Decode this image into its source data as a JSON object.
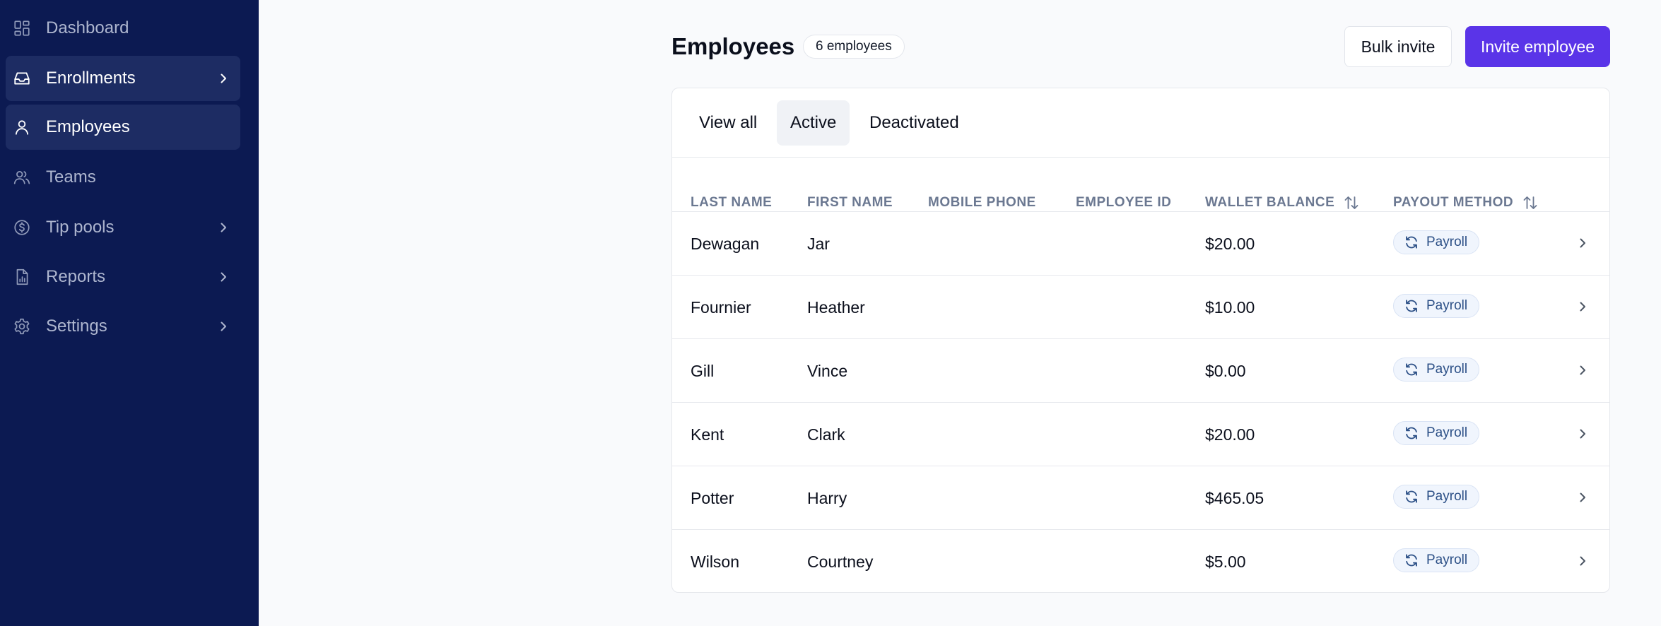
{
  "colors": {
    "sidebar_bg": "#0c1a52",
    "sidebar_active_bg": "#1d2c63",
    "accent": "#5a34e8",
    "badge_bg": "#f0f5fd",
    "badge_text": "#2b4f86"
  },
  "sidebar": {
    "items": [
      {
        "label": "Dashboard",
        "icon": "grid-icon"
      },
      {
        "label": "Enrollments",
        "icon": "inbox-icon",
        "has_chevron": true
      },
      {
        "label": "Employees",
        "icon": "user-icon",
        "selected": true
      },
      {
        "label": "Teams",
        "icon": "users-icon"
      },
      {
        "label": "Tip pools",
        "icon": "dollar-circle-icon",
        "has_chevron": true
      },
      {
        "label": "Reports",
        "icon": "report-icon",
        "has_chevron": true
      },
      {
        "label": "Settings",
        "icon": "gear-icon",
        "has_chevron": true
      }
    ]
  },
  "header": {
    "title": "Employees",
    "count_badge": "6 employees",
    "bulk_invite_label": "Bulk invite",
    "invite_label": "Invite employee"
  },
  "tabs": [
    {
      "label": "View all"
    },
    {
      "label": "Active",
      "active": true
    },
    {
      "label": "Deactivated"
    }
  ],
  "table": {
    "columns": [
      "LAST NAME",
      "FIRST NAME",
      "MOBILE PHONE",
      "EMPLOYEE ID",
      "WALLET BALANCE",
      "PAYOUT METHOD"
    ],
    "rows": [
      {
        "last_name": "Dewagan",
        "first_name": "Jar",
        "mobile_phone": "",
        "employee_id": "",
        "wallet_balance": "$20.00",
        "payout_method": "Payroll"
      },
      {
        "last_name": "Fournier",
        "first_name": "Heather",
        "mobile_phone": "",
        "employee_id": "",
        "wallet_balance": "$10.00",
        "payout_method": "Payroll"
      },
      {
        "last_name": "Gill",
        "first_name": "Vince",
        "mobile_phone": "",
        "employee_id": "",
        "wallet_balance": "$0.00",
        "payout_method": "Payroll"
      },
      {
        "last_name": "Kent",
        "first_name": "Clark",
        "mobile_phone": "",
        "employee_id": "",
        "wallet_balance": "$20.00",
        "payout_method": "Payroll"
      },
      {
        "last_name": "Potter",
        "first_name": "Harry",
        "mobile_phone": "",
        "employee_id": "",
        "wallet_balance": "$465.05",
        "payout_method": "Payroll"
      },
      {
        "last_name": "Wilson",
        "first_name": "Courtney",
        "mobile_phone": "",
        "employee_id": "",
        "wallet_balance": "$5.00",
        "payout_method": "Payroll"
      }
    ]
  }
}
